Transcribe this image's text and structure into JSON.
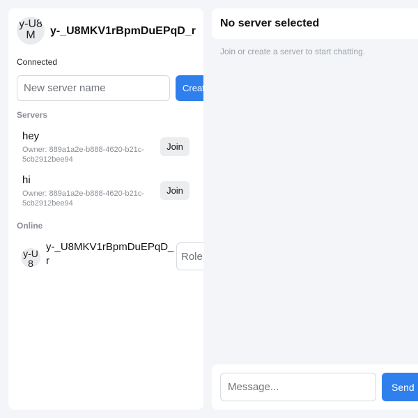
{
  "sidebar": {
    "me": {
      "avatar_alt": "y-U8M",
      "username": "y-_U8MKV1rBpmDuEPqD_r",
      "status": "Connected"
    },
    "new_server": {
      "placeholder": "New server name",
      "create_label": "Create"
    },
    "servers_heading": "Servers",
    "servers": [
      {
        "name": "hey",
        "owner": "Owner: 889a1a2e-b888-4620-b21c-5cb2912bee94",
        "join_label": "Join"
      },
      {
        "name": "hi",
        "owner": "Owner: 889a1a2e-b888-4620-b21c-5cb2912bee94",
        "join_label": "Join"
      }
    ],
    "online_heading": "Online",
    "online_users": [
      {
        "avatar_alt": "y-U8",
        "username": "y-_U8MKV1rBpmDuEPqD_r",
        "role_placeholder": "Role"
      }
    ]
  },
  "main": {
    "title": "No server selected",
    "hint": "Join or create a server to start chatting.",
    "composer": {
      "placeholder": "Message...",
      "send_label": "Send"
    }
  },
  "colors": {
    "accent": "#2f80ed",
    "background": "#f3f5f8",
    "panel": "#ffffff",
    "muted_text": "#8a8f96"
  }
}
